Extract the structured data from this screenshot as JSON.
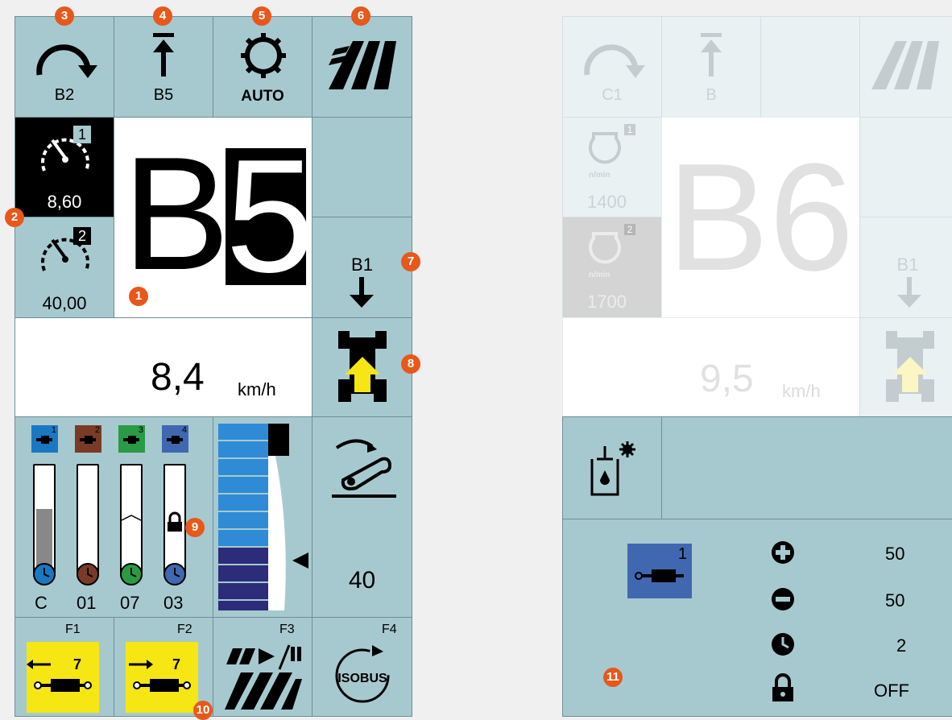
{
  "left": {
    "top_buttons": [
      {
        "label": "B2",
        "icon": "turn-arrow-icon",
        "callout": "3"
      },
      {
        "label": "B5",
        "icon": "lift-arrow-icon",
        "callout": "4"
      },
      {
        "label": "AUTO",
        "icon": "gear-auto-icon",
        "callout": "5"
      },
      {
        "label": "",
        "icon": "field-stripes-icon",
        "callout": "6"
      }
    ],
    "speed1": {
      "badge": "1",
      "value": "8,60"
    },
    "speed2": {
      "badge": "2",
      "value": "40,00"
    },
    "gear_display": {
      "letter": "B",
      "number": "5",
      "callout": "1"
    },
    "callout_speed": "2",
    "shift_down": {
      "label": "B1",
      "callout": "7"
    },
    "ground_speed": {
      "value": "8,4",
      "unit": "km/h"
    },
    "tractor_callout": "8",
    "valves": [
      {
        "num": "1",
        "color": "#1a78c2",
        "label": "C",
        "fill": 0.6
      },
      {
        "num": "2",
        "color": "#7a3a25",
        "label": "01",
        "fill": 0
      },
      {
        "num": "3",
        "color": "#2b9a45",
        "label": "07",
        "fill": 0
      },
      {
        "num": "4",
        "color": "#4068b0",
        "label": "03",
        "fill": 0
      }
    ],
    "lock_callout": "9",
    "pedal_value": "40",
    "fkeys": [
      {
        "key": "F1",
        "num": "7"
      },
      {
        "key": "F2",
        "num": "7"
      },
      {
        "key": "F3",
        "num": ""
      },
      {
        "key": "F4",
        "num": ""
      }
    ],
    "fkey_callout": "10",
    "isobus_label": "ISOBUS"
  },
  "right": {
    "top_buttons": [
      {
        "label": "C1"
      },
      {
        "label": "B"
      },
      {
        "label": ""
      },
      {
        "label": ""
      }
    ],
    "engine1": {
      "badge": "1",
      "unit": "n/min",
      "value": "1400"
    },
    "engine2": {
      "badge": "2",
      "unit": "n/min",
      "value": "1700"
    },
    "gear_display": "B6",
    "shift_down": {
      "label": "B1"
    },
    "ground_speed": {
      "value": "9,5",
      "unit": "km/h"
    },
    "valve_panel": {
      "num": "1",
      "rows": [
        {
          "icon": "plus-icon",
          "value": "50"
        },
        {
          "icon": "minus-icon",
          "value": "50"
        },
        {
          "icon": "clock-icon",
          "value": "2"
        },
        {
          "icon": "lock-icon",
          "value": "OFF"
        }
      ],
      "callout": "11"
    }
  },
  "colors": {
    "panel": "#a6c9cf",
    "callout": "#e8581a",
    "yellow": "#f5e614"
  }
}
